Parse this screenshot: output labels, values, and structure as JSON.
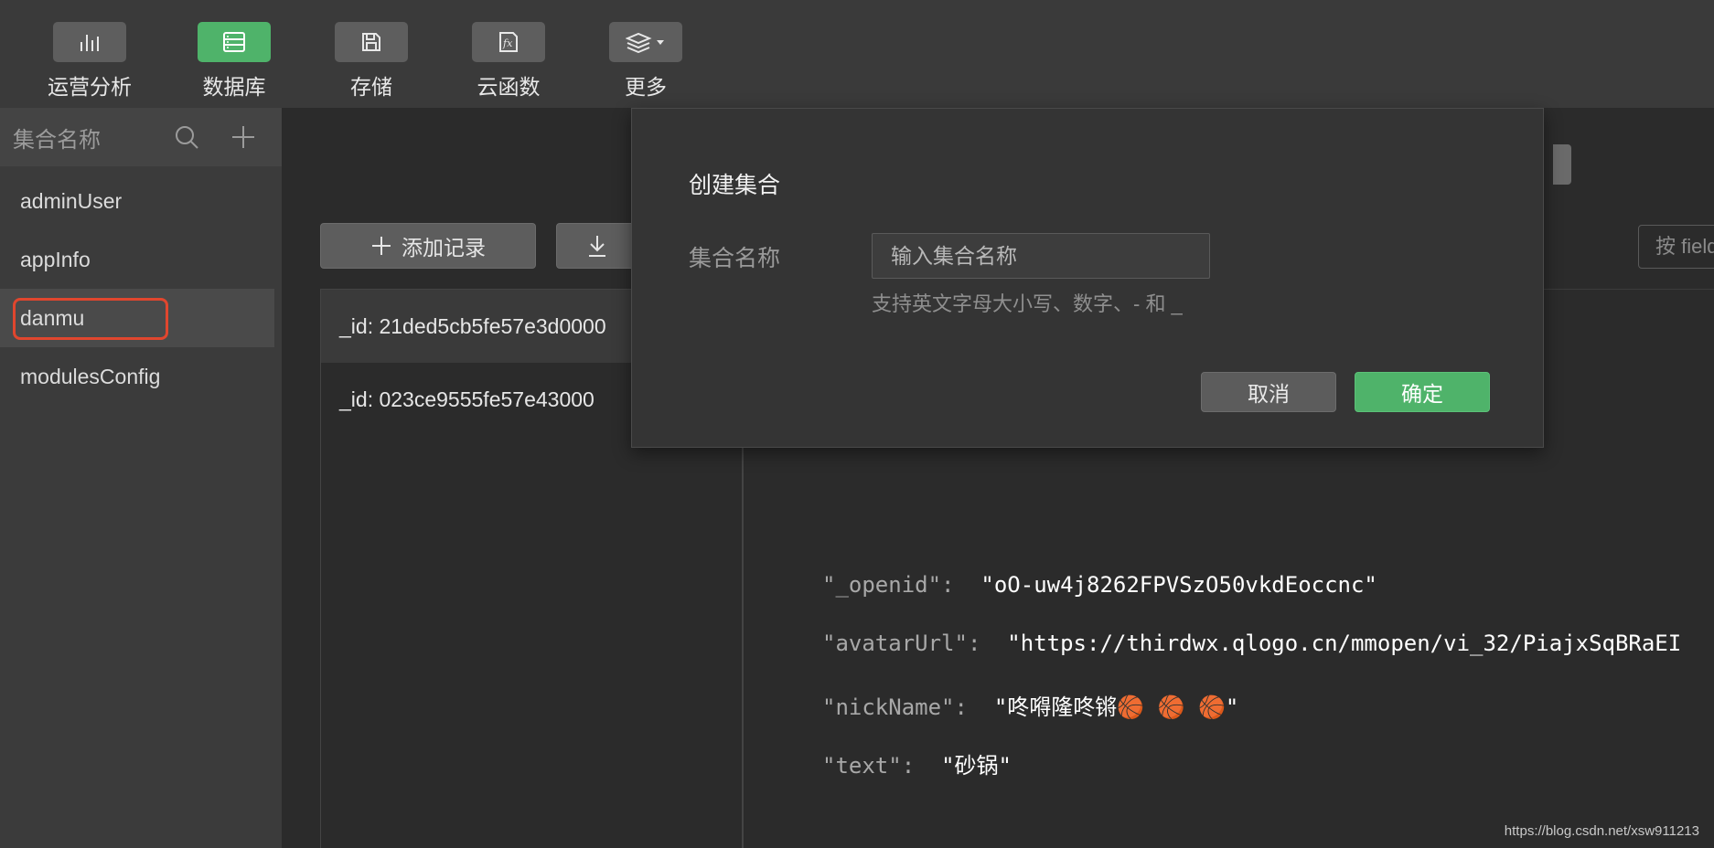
{
  "toolbar": {
    "items": [
      {
        "label": "运营分析",
        "icon": "bar-chart-icon",
        "active": false
      },
      {
        "label": "数据库",
        "icon": "database-icon",
        "active": true
      },
      {
        "label": "存储",
        "icon": "floppy-disk-icon",
        "active": false
      },
      {
        "label": "云函数",
        "icon": "function-fx-icon",
        "active": false
      },
      {
        "label": "更多",
        "icon": "layers-icon",
        "active": false
      }
    ]
  },
  "sidebar": {
    "title": "集合名称",
    "items": [
      {
        "label": "adminUser"
      },
      {
        "label": "appInfo"
      },
      {
        "label": "danmu",
        "selected": true
      },
      {
        "label": "modulesConfig"
      }
    ]
  },
  "main": {
    "add_record_label": "添加记录",
    "filter_placeholder": "按 field",
    "records": [
      {
        "label": "_id: 21ded5cb5fe57e3d0000"
      },
      {
        "label": "_id: 023ce9555fe57e43000"
      }
    ],
    "detail": [
      {
        "key": "\"_openid\":",
        "value": "\"oO-uw4j8262FPVSzO50vkdEoccnc\""
      },
      {
        "key": "\"avatarUrl\":",
        "value": "\"https://thirdwx.qlogo.cn/mmopen/vi_32/PiajxSqBRaEI"
      },
      {
        "key": "\"nickName\":",
        "value": "\"咚嘚隆咚锵🏀 🏀 🏀\""
      },
      {
        "key": "\"text\":",
        "value": "\"砂锅\""
      }
    ]
  },
  "modal": {
    "title": "创建集合",
    "field_label": "集合名称",
    "input_placeholder": "输入集合名称",
    "input_value": "",
    "hint": "支持英文字母大小写、数字、- 和 _",
    "cancel_label": "取消",
    "confirm_label": "确定"
  },
  "watermark": "https://blog.csdn.net/xsw911213",
  "colors": {
    "accent_green": "#4fb36a",
    "highlight_red": "#e0462e",
    "background": "#2b2b2b"
  }
}
